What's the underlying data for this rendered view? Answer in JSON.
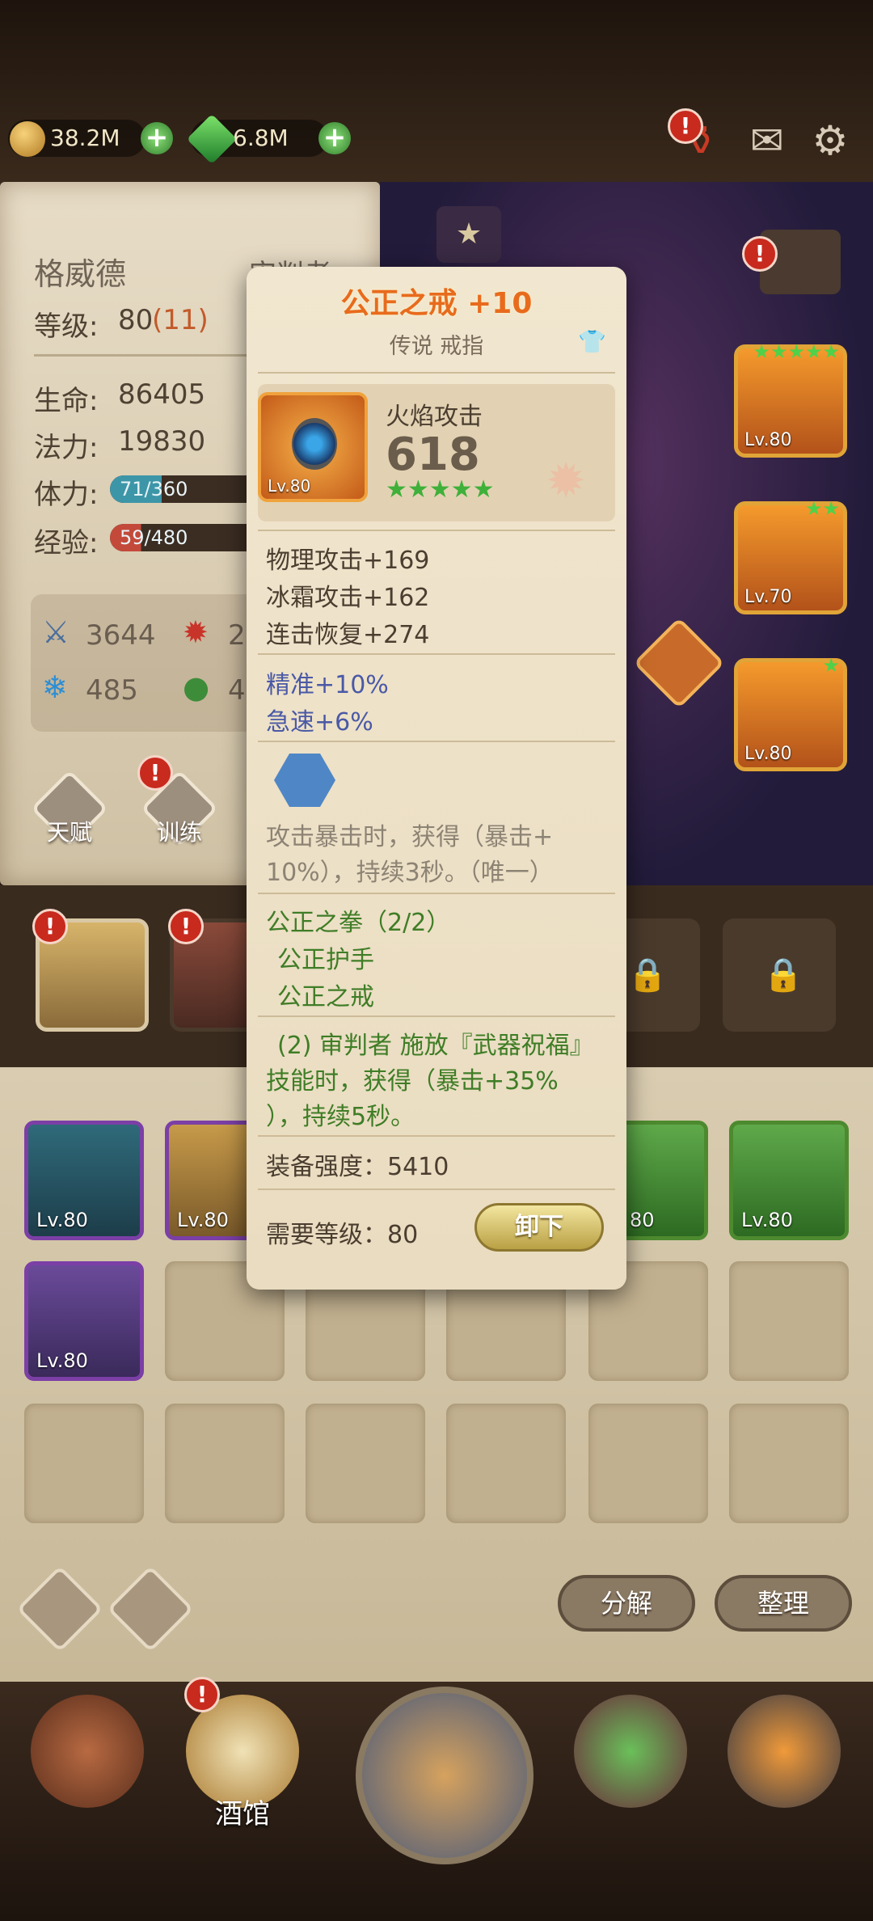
{
  "top_bar": {
    "gold": "38.2M",
    "gems": "6.8M"
  },
  "hero": {
    "name": "格威德",
    "class_label": "审判者",
    "level_label": "等级:",
    "level": "80",
    "level_bonus": "(11)",
    "hp_label": "生命:",
    "hp": "86405",
    "mana_label": "法力:",
    "mana": "19830",
    "stamina_label": "体力:",
    "stamina_value": "71/360",
    "stamina_fraction": 0.197,
    "exp_label": "经验:",
    "exp_value": "59/480",
    "exp_fraction": 0.123,
    "attr_attack": "3644",
    "attr_fire": "2",
    "attr_ice": "485",
    "attr_nature": "4"
  },
  "left_buttons": {
    "talent": "天赋",
    "training": "训练"
  },
  "equip_slots": [
    {
      "level": "Lv.80"
    },
    {
      "level": "Lv.70"
    },
    {
      "level": "Lv.80"
    }
  ],
  "inventory": {
    "row1": [
      {
        "level": "Lv.80",
        "color": "#6b3a99"
      },
      {
        "level": "Lv.80",
        "color": "#7b3fa6"
      },
      {
        "level": "",
        "color": ""
      },
      {
        "level": "",
        "color": ""
      },
      {
        "level": "80",
        "color": "#4d8a2f"
      },
      {
        "level": "Lv.80",
        "color": "#4d8a2f"
      }
    ],
    "row2_first": {
      "level": "Lv.80",
      "color": "#6b3a99"
    },
    "decompose_button": "分解",
    "sort_button": "整理"
  },
  "nav": {
    "tavern": "酒馆"
  },
  "tooltip": {
    "title": "公正之戒 +10",
    "subtitle": "传说 戒指",
    "item_level": "Lv.80",
    "main_stat_label": "火焰攻击",
    "main_stat_value": "618",
    "stars": "★★★★★",
    "stats": [
      "物理攻击+169",
      "冰霜攻击+162",
      "连击恢复+274"
    ],
    "bonus": [
      "精准+10%",
      "急速+6%"
    ],
    "passive_line1": "攻击暴击时，获得（暴击+",
    "passive_line2": "10%），持续3秒。（唯一）",
    "set_name": "公正之拳（2/2）",
    "set_items": [
      "公正护手",
      "公正之戒"
    ],
    "set_bonus_line1": "(2) 审判者 施放『武器祝福』",
    "set_bonus_line2": "技能时，获得（暴击+35%",
    "set_bonus_line3": "），持续5秒。",
    "gear_score": "装备强度：5410",
    "required_level": "需要等级：80",
    "unequip_button": "卸下"
  }
}
